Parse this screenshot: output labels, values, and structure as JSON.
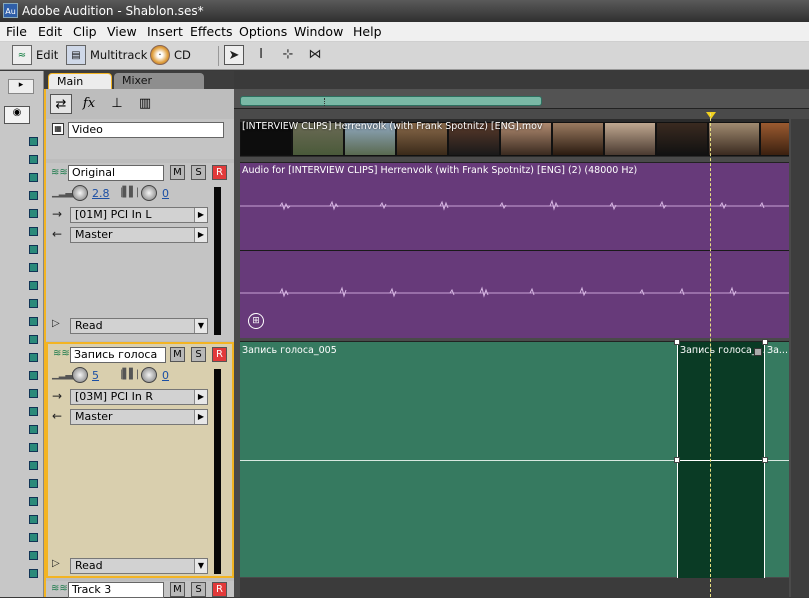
{
  "window": {
    "app_icon_label": "Au",
    "title": "Adobe Audition - Shablon.ses*"
  },
  "menu": [
    "File",
    "Edit",
    "Clip",
    "View",
    "Insert",
    "Effects",
    "Options",
    "Window",
    "Help"
  ],
  "toolbar": {
    "edit_label": "Edit",
    "multitrack_label": "Multitrack",
    "cd_label": "CD"
  },
  "tabs": {
    "main": "Main",
    "mixer": "Mixer"
  },
  "header_tools": {
    "fx_label": "fx"
  },
  "tracks": {
    "video": {
      "name": "Video"
    },
    "original": {
      "name": "Original",
      "m": "M",
      "s": "S",
      "r": "R",
      "volume": "2.8",
      "pan": "0",
      "input": "[01M] PCI In L",
      "output": "Master",
      "automation": "Read"
    },
    "voice": {
      "name": "Запись голоса",
      "m": "M",
      "s": "S",
      "r": "R",
      "volume": "5",
      "pan": "0",
      "input": "[03M] PCI In R",
      "output": "Master",
      "automation": "Read"
    },
    "track3": {
      "name": "Track 3",
      "m": "M",
      "s": "S",
      "r": "R"
    }
  },
  "clips": {
    "video_clip": "[INTERVIEW CLIPS] Herrenvolk (with Frank Spotnitz) [ENG].mov",
    "audio_clip": "Audio for [INTERVIEW CLIPS] Herrenvolk (with Frank Spotnitz) [ENG] (2) (48000 Hz)",
    "voice_clip_1": "Запись голоса_005",
    "voice_clip_2": "Запись голоса_...",
    "voice_clip_3": "За..."
  },
  "colors": {
    "selection_accent": "#f3b422",
    "audio_clip": "#673a7a",
    "voice_clip": "#367a60",
    "voice_clip_selected": "#0a3b25",
    "record_arm": "#e23a3a"
  }
}
